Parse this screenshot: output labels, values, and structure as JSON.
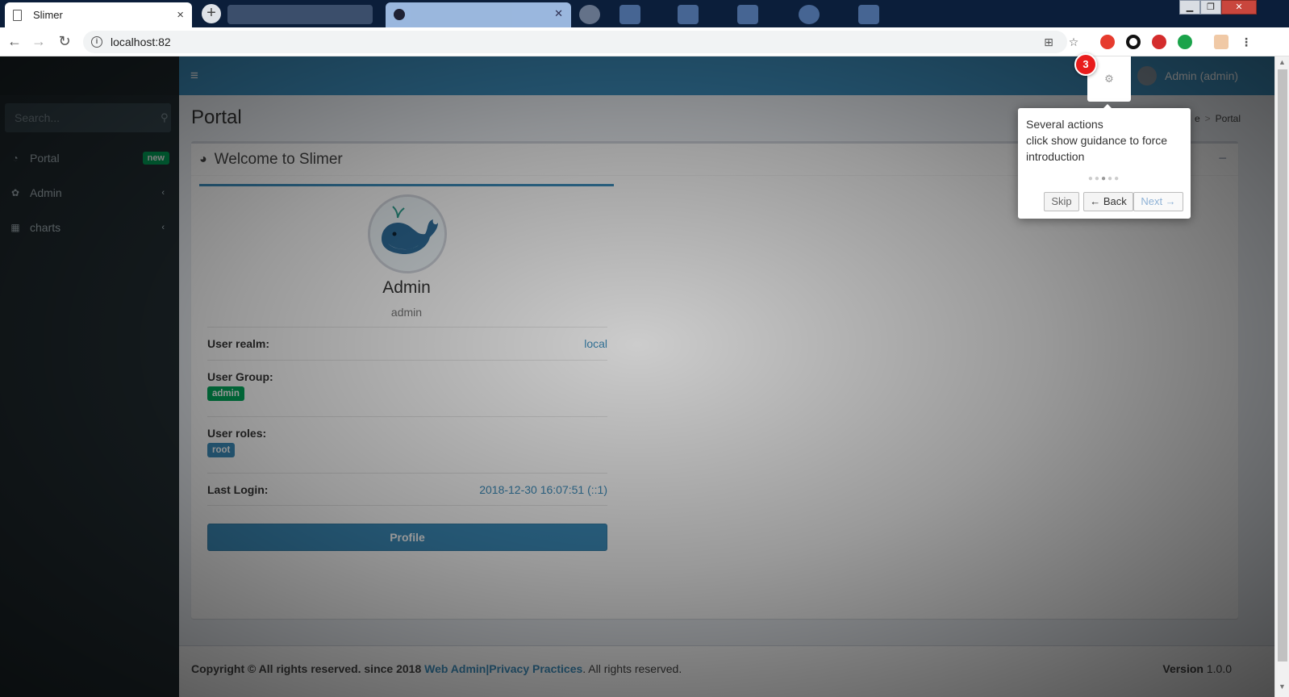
{
  "browser": {
    "tab_title": "Slimer",
    "tab_close": "×",
    "new_tab": "+",
    "url": "localhost:82",
    "win_min": "▁",
    "win_max": "❐",
    "win_close": "✕"
  },
  "sidebar": {
    "search_placeholder": "Search...",
    "items": [
      {
        "label": "Portal",
        "icon": "dashboard-icon",
        "badge": "new"
      },
      {
        "label": "Admin",
        "icon": "gear-icon"
      },
      {
        "label": "charts",
        "icon": "grid-icon"
      }
    ]
  },
  "header": {
    "actions_step": "3",
    "user_label": "Admin (admin)"
  },
  "content": {
    "page_title": "Portal",
    "breadcrumb": [
      "e",
      "Portal"
    ],
    "box_title": "Welcome to Slimer",
    "profile": {
      "name": "Admin",
      "username": "admin",
      "realm_label": "User realm:",
      "realm_value": "local",
      "group_label": "User Group:",
      "group_value": "admin",
      "roles_label": "User roles:",
      "roles_value": "root",
      "last_login_label": "Last Login:",
      "last_login_value": "2018-12-30 16:07:51 (::1)",
      "button": "Profile"
    }
  },
  "footer": {
    "copyright": "Copyright © All rights reserved. since 2018",
    "link1": "Web Admin",
    "sep": "|",
    "link2": "Privacy Practices",
    "suffix": ". All rights reserved.",
    "version_label": "Version",
    "version_value": "1.0.0"
  },
  "tooltip": {
    "line1": "Several actions",
    "line2": "click show guidance to force",
    "line3": "introduction",
    "skip": "Skip",
    "back": "← Back",
    "next": "Next →"
  },
  "colors": {
    "primary": "#3c8dbc",
    "sidebar": "#222d32",
    "success": "#00a65a",
    "badge_red": "#e81c1c"
  }
}
